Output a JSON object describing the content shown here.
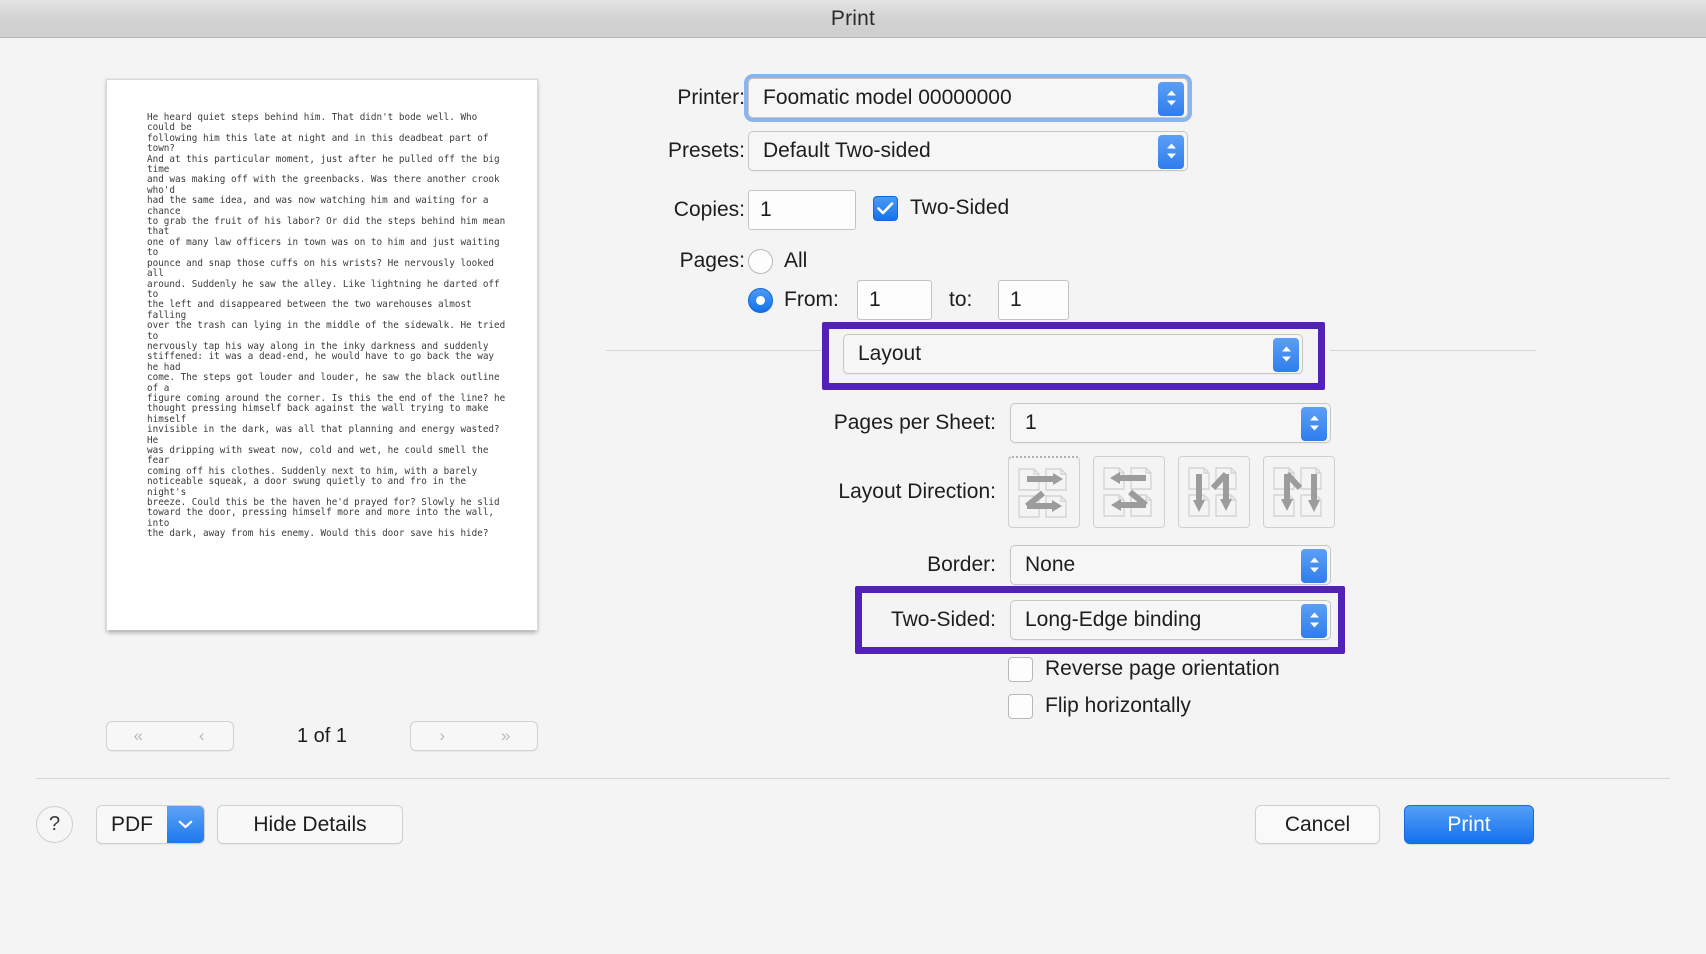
{
  "window": {
    "title": "Print"
  },
  "preview": {
    "document_text": "He heard quiet steps behind him. That didn't bode well. Who could be\nfollowing him this late at night and in this deadbeat part of town?\nAnd at this particular moment, just after he pulled off the big time\nand was making off with the greenbacks. Was there another crook who'd\nhad the same idea, and was now watching him and waiting for a chance\nto grab the fruit of his labor? Or did the steps behind him mean that\none of many law officers in town was on to him and just waiting to\npounce and snap those cuffs on his wrists? He nervously looked all\naround. Suddenly he saw the alley. Like lightning he darted off to\nthe left and disappeared between the two warehouses almost falling\nover the trash can lying in the middle of the sidewalk. He tried to\nnervously tap his way along in the inky darkness and suddenly\nstiffened: it was a dead-end, he would have to go back the way he had\ncome. The steps got louder and louder, he saw the black outline of a\nfigure coming around the corner. Is this the end of the line? he\nthought pressing himself back against the wall trying to make himself\ninvisible in the dark, was all that planning and energy wasted? He\nwas dripping with sweat now, cold and wet, he could smell the fear\ncoming off his clothes. Suddenly next to him, with a barely\nnoticeable squeak, a door swung quietly to and fro in the night's\nbreeze. Could this be the haven he'd prayed for? Slowly he slid\ntoward the door, pressing himself more and more into the wall, into\nthe dark, away from his enemy. Would this door save his hide?",
    "nav": {
      "first_label": "«",
      "prev_label": "‹",
      "next_label": "›",
      "last_label": "»",
      "page_count_label": "1 of 1"
    }
  },
  "settings": {
    "printer": {
      "label": "Printer:",
      "value": "Foomatic model 00000000",
      "focused": true
    },
    "presets": {
      "label": "Presets:",
      "value": "Default Two-sided"
    },
    "copies": {
      "label": "Copies:",
      "value": "1"
    },
    "two_sided_checkbox": {
      "label": "Two-Sided",
      "checked": true,
      "check_glyph": "✓"
    },
    "pages": {
      "label": "Pages:",
      "all_label": "All",
      "all_selected": false,
      "from_label": "From:",
      "from_selected": true,
      "from_value": "1",
      "to_label": "to:",
      "to_value": "1"
    },
    "pane_selector": {
      "value": "Layout",
      "highlighted": true
    },
    "pages_per_sheet": {
      "label": "Pages per Sheet:",
      "value": "1"
    },
    "layout_direction": {
      "label": "Layout Direction:",
      "selected_index": 0,
      "options": [
        {
          "name": "across-right-then-down",
          "icon": "z-right-down-icon"
        },
        {
          "name": "across-left-then-down",
          "icon": "z-left-down-icon"
        },
        {
          "name": "down-then-across-right",
          "icon": "n-down-right-icon"
        },
        {
          "name": "down-then-across-left",
          "icon": "n-down-left-icon"
        }
      ]
    },
    "border": {
      "label": "Border:",
      "value": "None"
    },
    "two_sided_popup": {
      "label": "Two-Sided:",
      "value": "Long-Edge binding",
      "highlighted": true
    },
    "reverse_page_orientation": {
      "label": "Reverse page orientation",
      "checked": false
    },
    "flip_horizontally": {
      "label": "Flip horizontally",
      "checked": false
    }
  },
  "footer": {
    "help_label": "?",
    "pdf_label": "PDF",
    "hide_details_label": "Hide Details",
    "cancel_label": "Cancel",
    "print_label": "Print"
  },
  "colors": {
    "accent_blue": "#1e78ee",
    "focus_ring": "#8ab4f0",
    "highlight_purple": "#5222b8",
    "window_bg": "#f4f4f4"
  }
}
